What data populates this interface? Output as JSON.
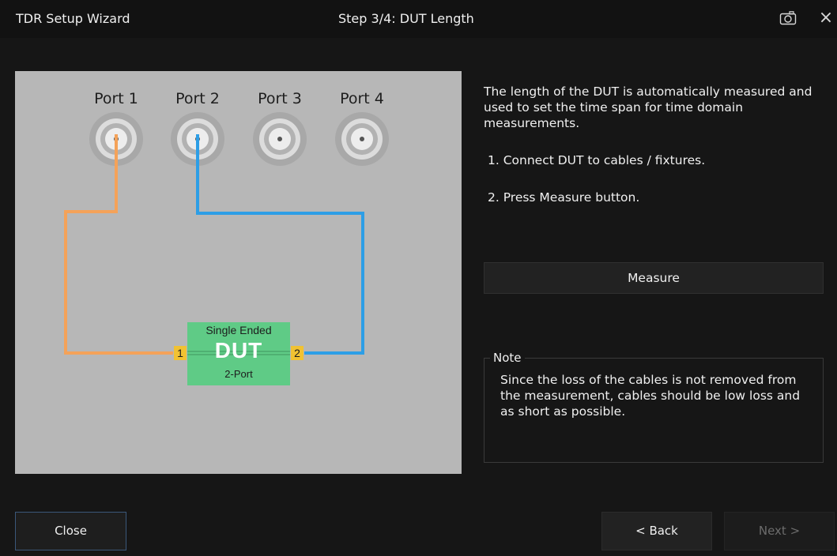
{
  "window": {
    "app_title": "TDR Setup Wizard",
    "step_title": "Step 3/4: DUT Length",
    "camera_icon": "camera-icon",
    "close_icon": "close-icon",
    "close_glyph": "×"
  },
  "diagram": {
    "ports": [
      "Port 1",
      "Port 2",
      "Port 3",
      "Port 4"
    ],
    "dut": {
      "top_label": "Single Ended",
      "main_label": "DUT",
      "bottom_label": "2-Port",
      "pin_left": "1",
      "pin_right": "2"
    },
    "colors": {
      "cable_port1": "#f4a259",
      "cable_port2": "#2d9ee6",
      "dut_fill": "#5fcb86",
      "pin_fill": "#f1c232",
      "panel_bg": "#b7b7b7"
    }
  },
  "instructions": {
    "description": "The length of the DUT is automatically measured and used to set the time span for time domain measurements.",
    "step1": "1. Connect DUT to cables / fixtures.",
    "step2": "2. Press Measure button."
  },
  "measure_button": "Measure",
  "note": {
    "legend": "Note",
    "text": "Since the loss of the cables is not removed from the measurement, cables should be low loss and as short as possible."
  },
  "footer": {
    "close_label": "Close",
    "back_label": "< Back",
    "next_label": "Next >"
  }
}
